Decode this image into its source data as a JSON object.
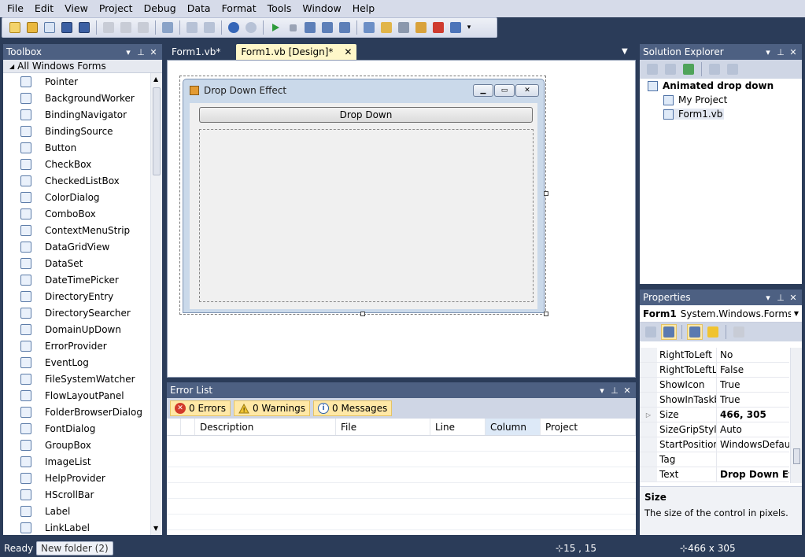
{
  "menu": [
    "File",
    "Edit",
    "View",
    "Project",
    "Debug",
    "Data",
    "Format",
    "Tools",
    "Window",
    "Help"
  ],
  "toolbox": {
    "title": "Toolbox",
    "group": "All Windows Forms",
    "items": [
      {
        "label": "Pointer",
        "icon": "pointer-icon"
      },
      {
        "label": "BackgroundWorker",
        "icon": "backgroundworker-icon"
      },
      {
        "label": "BindingNavigator",
        "icon": "bindingnavigator-icon"
      },
      {
        "label": "BindingSource",
        "icon": "bindingsource-icon"
      },
      {
        "label": "Button",
        "icon": "button-icon"
      },
      {
        "label": "CheckBox",
        "icon": "checkbox-icon"
      },
      {
        "label": "CheckedListBox",
        "icon": "checkedlistbox-icon"
      },
      {
        "label": "ColorDialog",
        "icon": "colordialog-icon"
      },
      {
        "label": "ComboBox",
        "icon": "combobox-icon"
      },
      {
        "label": "ContextMenuStrip",
        "icon": "contextmenustrip-icon"
      },
      {
        "label": "DataGridView",
        "icon": "datagridview-icon"
      },
      {
        "label": "DataSet",
        "icon": "dataset-icon"
      },
      {
        "label": "DateTimePicker",
        "icon": "datetimepicker-icon"
      },
      {
        "label": "DirectoryEntry",
        "icon": "directoryentry-icon"
      },
      {
        "label": "DirectorySearcher",
        "icon": "directorysearcher-icon"
      },
      {
        "label": "DomainUpDown",
        "icon": "domainupdown-icon"
      },
      {
        "label": "ErrorProvider",
        "icon": "errorprovider-icon"
      },
      {
        "label": "EventLog",
        "icon": "eventlog-icon"
      },
      {
        "label": "FileSystemWatcher",
        "icon": "filesystemwatcher-icon"
      },
      {
        "label": "FlowLayoutPanel",
        "icon": "flowlayoutpanel-icon"
      },
      {
        "label": "FolderBrowserDialog",
        "icon": "folderbrowserdialog-icon"
      },
      {
        "label": "FontDialog",
        "icon": "fontdialog-icon"
      },
      {
        "label": "GroupBox",
        "icon": "groupbox-icon"
      },
      {
        "label": "ImageList",
        "icon": "imagelist-icon"
      },
      {
        "label": "HelpProvider",
        "icon": "helpprovider-icon"
      },
      {
        "label": "HScrollBar",
        "icon": "hscrollbar-icon"
      },
      {
        "label": "Label",
        "icon": "label-icon"
      },
      {
        "label": "LinkLabel",
        "icon": "linklabel-icon"
      }
    ]
  },
  "tabs": [
    {
      "label": "Form1.vb*",
      "active": false
    },
    {
      "label": "Form1.vb [Design]*",
      "active": true
    }
  ],
  "form": {
    "title": "Drop Down Effect",
    "button_label": "Drop Down"
  },
  "errorlist": {
    "title": "Error List",
    "errors": "0 Errors",
    "warnings": "0 Warnings",
    "messages": "0 Messages",
    "columns": [
      "",
      "Description",
      "File",
      "Line",
      "Column",
      "Project"
    ]
  },
  "solution_explorer": {
    "title": "Solution Explorer",
    "project": "Animated drop down",
    "children": [
      "My Project",
      "Form1.vb"
    ]
  },
  "properties": {
    "title": "Properties",
    "object_name": "Form1",
    "object_type": "System.Windows.Forms.Fo",
    "rows": [
      {
        "name": "RightToLeft",
        "value": "No",
        "bold": false
      },
      {
        "name": "RightToLeftLa",
        "value": "False",
        "bold": false
      },
      {
        "name": "ShowIcon",
        "value": "True",
        "bold": false
      },
      {
        "name": "ShowInTaskb",
        "value": "True",
        "bold": false
      },
      {
        "name": "Size",
        "value": "466, 305",
        "bold": true
      },
      {
        "name": "SizeGripStyle",
        "value": "Auto",
        "bold": false
      },
      {
        "name": "StartPosition",
        "value": "WindowsDefault",
        "bold": false
      },
      {
        "name": "Tag",
        "value": "",
        "bold": false
      },
      {
        "name": "Text",
        "value": "Drop Down Effe",
        "bold": true
      }
    ],
    "desc_title": "Size",
    "desc_text": "The size of the control in pixels."
  },
  "status": {
    "ready": "Ready",
    "task_button": "New folder (2)",
    "position": "15 , 15",
    "size": "466 x 305"
  },
  "colors": {
    "chrome_bg": "#2b3c59",
    "panel_title": "#4d6082",
    "active_tab": "#fff7c9",
    "highlight_button": "#ffe8a6"
  }
}
